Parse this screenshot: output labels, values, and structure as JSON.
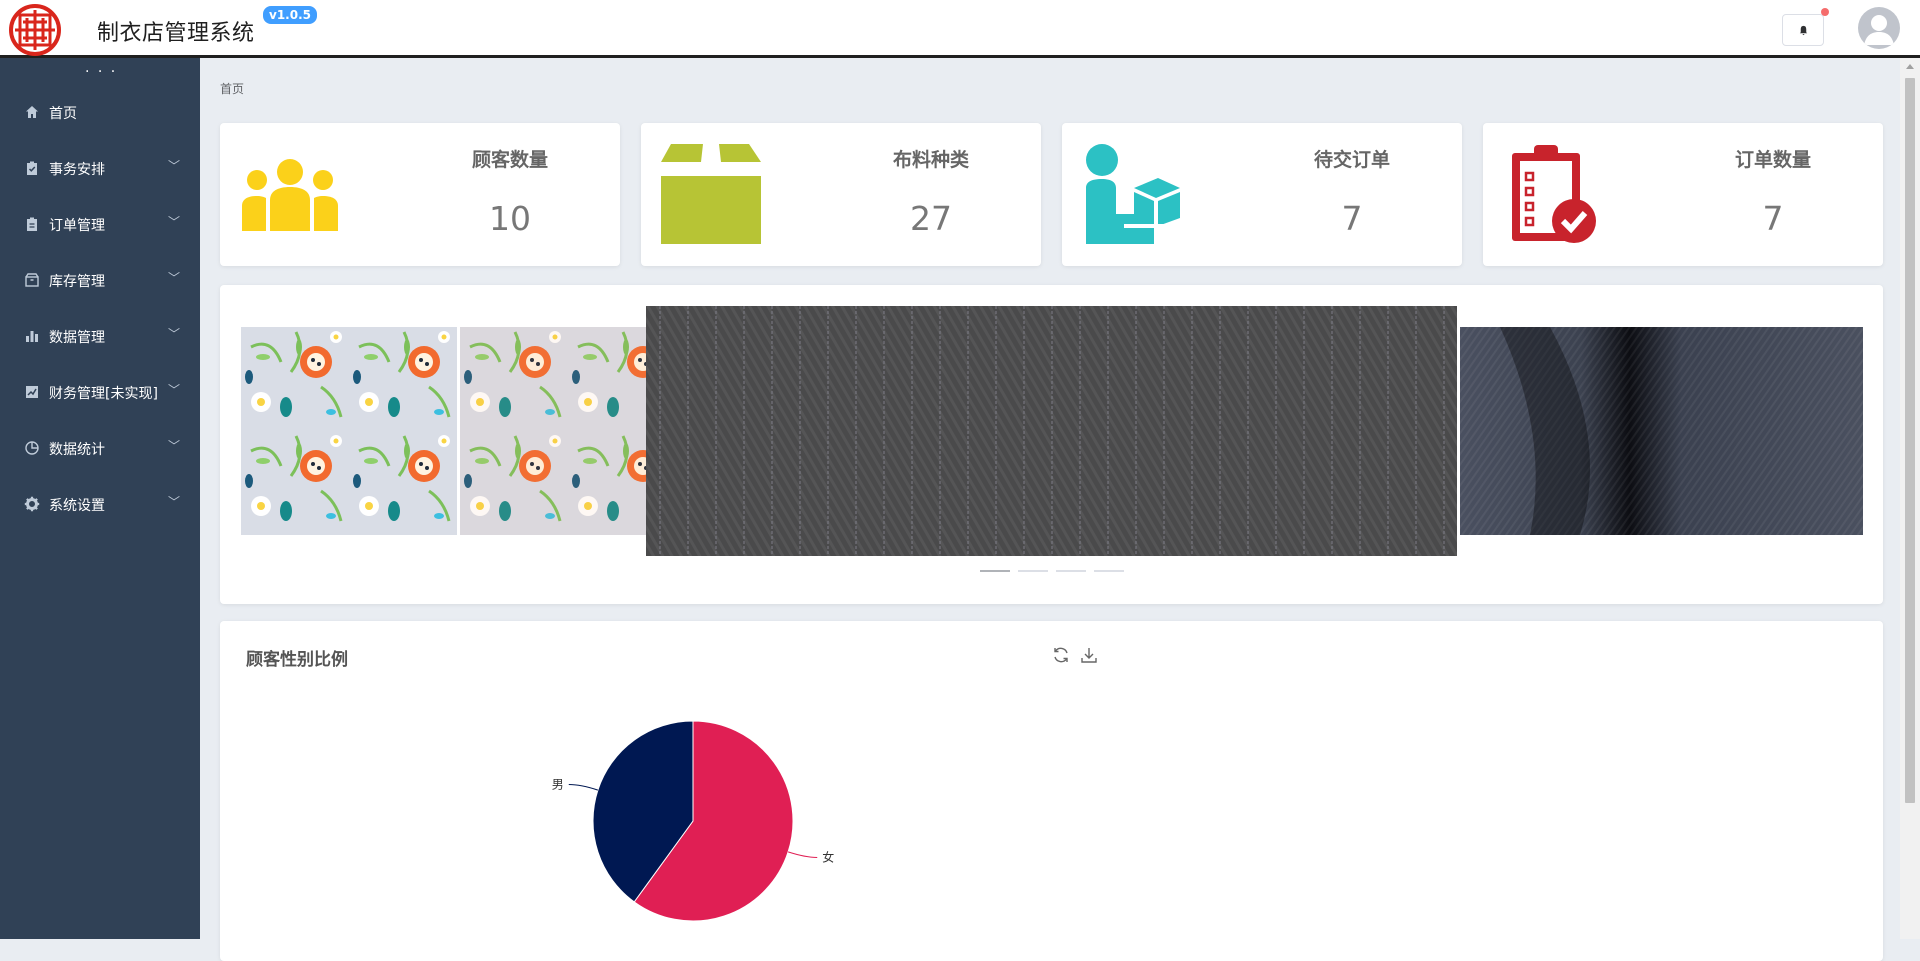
{
  "app": {
    "title": "制衣店管理系统",
    "version": "v1.0.5",
    "brand_color": "#d9261c"
  },
  "header": {
    "bell_icon": "bell-icon",
    "avatar_icon": "user-avatar"
  },
  "sidebar": {
    "collapse_label": "· · ·",
    "items": [
      {
        "label": "首页",
        "icon": "home-icon",
        "has_submenu": false
      },
      {
        "label": "事务安排",
        "icon": "clipboard-check-icon",
        "has_submenu": true
      },
      {
        "label": "订单管理",
        "icon": "clipboard-icon",
        "has_submenu": true
      },
      {
        "label": "库存管理",
        "icon": "box-icon",
        "has_submenu": true
      },
      {
        "label": "数据管理",
        "icon": "bar-chart-icon",
        "has_submenu": true
      },
      {
        "label": "财务管理[未实现]",
        "icon": "line-chart-icon",
        "has_submenu": true
      },
      {
        "label": "数据统计",
        "icon": "pie-chart-icon",
        "has_submenu": true
      },
      {
        "label": "系统设置",
        "icon": "gear-icon",
        "has_submenu": true
      }
    ]
  },
  "breadcrumb": "首页",
  "stats": [
    {
      "title": "顾客数量",
      "value": "10",
      "icon": "people-icon",
      "color": "#fbd11a"
    },
    {
      "title": "布料种类",
      "value": "27",
      "icon": "box-open-icon",
      "color": "#b7c435"
    },
    {
      "title": "待交订单",
      "value": "7",
      "icon": "person-package-icon",
      "color": "#2cc1c4"
    },
    {
      "title": "订单数量",
      "value": "7",
      "icon": "clipboard-check-icon",
      "color": "#c8232c"
    }
  ],
  "carousel": {
    "slides": [
      "floral-fabric-1",
      "floral-fabric-2",
      "pinstripe-wool-fabric",
      "navy-twill-fabric"
    ],
    "active_index": 0,
    "dot_count": 4
  },
  "gender_chart": {
    "title": "顾客性别比例",
    "refresh_icon": "refresh-icon",
    "download_icon": "download-icon"
  },
  "chart_data": {
    "type": "pie",
    "title": "顾客性别比例",
    "slices": [
      {
        "label": "女",
        "value": 6,
        "color": "#e01f54"
      },
      {
        "label": "男",
        "value": 4,
        "color": "#001852"
      }
    ]
  }
}
